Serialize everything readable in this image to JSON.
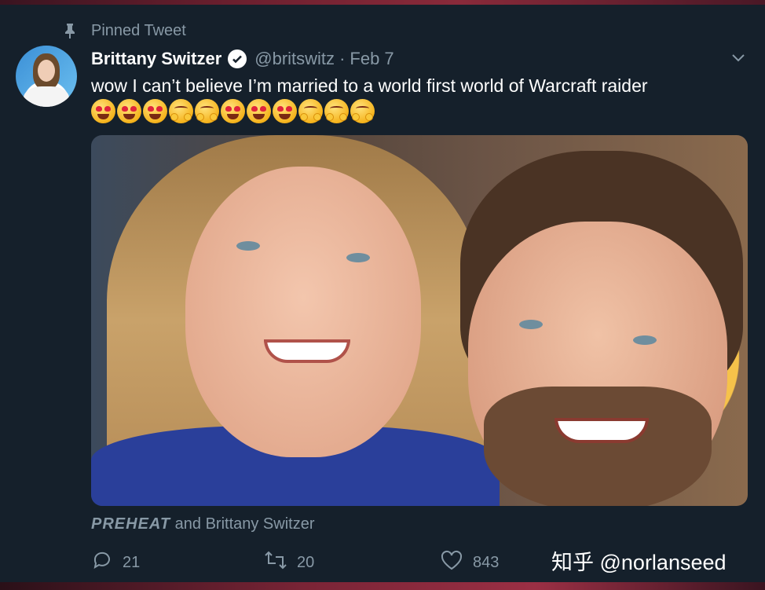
{
  "pinned_label": "Pinned Tweet",
  "tweet": {
    "author_name": "Brittany Switzer",
    "handle": "@britswitz",
    "separator": "·",
    "date": "Feb 7",
    "text": "wow I can’t believe I’m married to a world first world of Warcraft raider",
    "emojis": [
      "heart-eyes",
      "heart-eyes",
      "heart-eyes",
      "hugging",
      "hugging",
      "heart-eyes",
      "heart-eyes",
      "heart-eyes",
      "hugging",
      "hugging",
      "hugging"
    ]
  },
  "credit": {
    "brand": "PREHEAT",
    "rest": " and Brittany Switzer"
  },
  "actions": {
    "replies": "21",
    "retweets": "20",
    "likes": "843"
  },
  "watermark": "知乎 @norlanseed",
  "colors": {
    "background": "#15202b",
    "secondary_text": "#8899a6",
    "primary_text": "#ffffff"
  },
  "icons": [
    "pin-icon",
    "verified-badge-icon",
    "chevron-down-icon",
    "reply-icon",
    "retweet-icon",
    "like-icon"
  ]
}
